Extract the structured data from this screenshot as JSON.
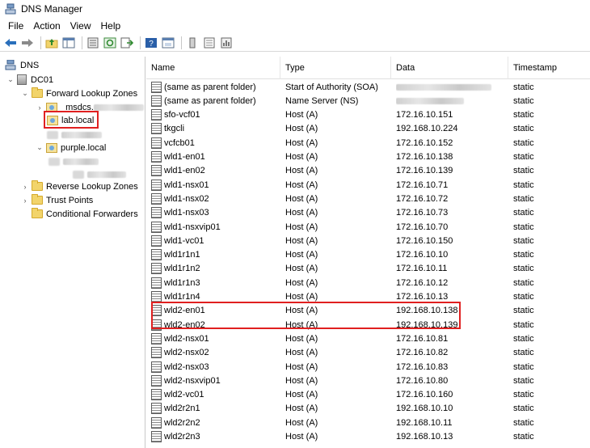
{
  "window": {
    "title": "DNS Manager"
  },
  "menu": [
    "File",
    "Action",
    "View",
    "Help"
  ],
  "toolbar": [
    "back-icon",
    "forward-icon",
    "up-folder-icon",
    "show-hide-tree-icon",
    "properties-icon",
    "refresh-icon",
    "export-icon",
    "help-icon",
    "console-icon",
    "server-icon",
    "records-icon",
    "stats-icon"
  ],
  "tree": {
    "root": "DNS",
    "server": "DC01",
    "forward_zones": "Forward Lookup Zones",
    "msdcs": "_msdcs.",
    "selected_zone": "lab.local",
    "purple_zone": "purple.local",
    "reverse_zones": "Reverse Lookup Zones",
    "trust_points": "Trust Points",
    "conditional_forwarders": "Conditional Forwarders"
  },
  "columns": [
    "Name",
    "Type",
    "Data",
    "Timestamp"
  ],
  "records": [
    {
      "name": "(same as parent folder)",
      "type": "Start of Authority (SOA)",
      "data": "",
      "ts": "static"
    },
    {
      "name": "(same as parent folder)",
      "type": "Name Server (NS)",
      "data": "",
      "ts": "static"
    },
    {
      "name": "sfo-vcf01",
      "type": "Host (A)",
      "data": "172.16.10.151",
      "ts": "static"
    },
    {
      "name": "tkgcli",
      "type": "Host (A)",
      "data": "192.168.10.224",
      "ts": "static"
    },
    {
      "name": "vcfcb01",
      "type": "Host (A)",
      "data": "172.16.10.152",
      "ts": "static"
    },
    {
      "name": "wld1-en01",
      "type": "Host (A)",
      "data": "172.16.10.138",
      "ts": "static"
    },
    {
      "name": "wld1-en02",
      "type": "Host (A)",
      "data": "172.16.10.139",
      "ts": "static"
    },
    {
      "name": "wld1-nsx01",
      "type": "Host (A)",
      "data": "172.16.10.71",
      "ts": "static"
    },
    {
      "name": "wld1-nsx02",
      "type": "Host (A)",
      "data": "172.16.10.72",
      "ts": "static"
    },
    {
      "name": "wld1-nsx03",
      "type": "Host (A)",
      "data": "172.16.10.73",
      "ts": "static"
    },
    {
      "name": "wld1-nsxvip01",
      "type": "Host (A)",
      "data": "172.16.10.70",
      "ts": "static"
    },
    {
      "name": "wld1-vc01",
      "type": "Host (A)",
      "data": "172.16.10.150",
      "ts": "static"
    },
    {
      "name": "wld1r1n1",
      "type": "Host (A)",
      "data": "172.16.10.10",
      "ts": "static"
    },
    {
      "name": "wld1r1n2",
      "type": "Host (A)",
      "data": "172.16.10.11",
      "ts": "static"
    },
    {
      "name": "wld1r1n3",
      "type": "Host (A)",
      "data": "172.16.10.12",
      "ts": "static"
    },
    {
      "name": "wld1r1n4",
      "type": "Host (A)",
      "data": "172.16.10.13",
      "ts": "static"
    },
    {
      "name": "wld2-en01",
      "type": "Host (A)",
      "data": "192.168.10.138",
      "ts": "static"
    },
    {
      "name": "wld2-en02",
      "type": "Host (A)",
      "data": "192.168.10.139",
      "ts": "static"
    },
    {
      "name": "wld2-nsx01",
      "type": "Host (A)",
      "data": "172.16.10.81",
      "ts": "static"
    },
    {
      "name": "wld2-nsx02",
      "type": "Host (A)",
      "data": "172.16.10.82",
      "ts": "static"
    },
    {
      "name": "wld2-nsx03",
      "type": "Host (A)",
      "data": "172.16.10.83",
      "ts": "static"
    },
    {
      "name": "wld2-nsxvip01",
      "type": "Host (A)",
      "data": "172.16.10.80",
      "ts": "static"
    },
    {
      "name": "wld2-vc01",
      "type": "Host (A)",
      "data": "172.16.10.160",
      "ts": "static"
    },
    {
      "name": "wld2r2n1",
      "type": "Host (A)",
      "data": "192.168.10.10",
      "ts": "static"
    },
    {
      "name": "wld2r2n2",
      "type": "Host (A)",
      "data": "192.168.10.11",
      "ts": "static"
    },
    {
      "name": "wld2r2n3",
      "type": "Host (A)",
      "data": "192.168.10.13",
      "ts": "static"
    }
  ],
  "colors": {
    "highlight": "#e02020",
    "folder": "#f2d46b"
  }
}
